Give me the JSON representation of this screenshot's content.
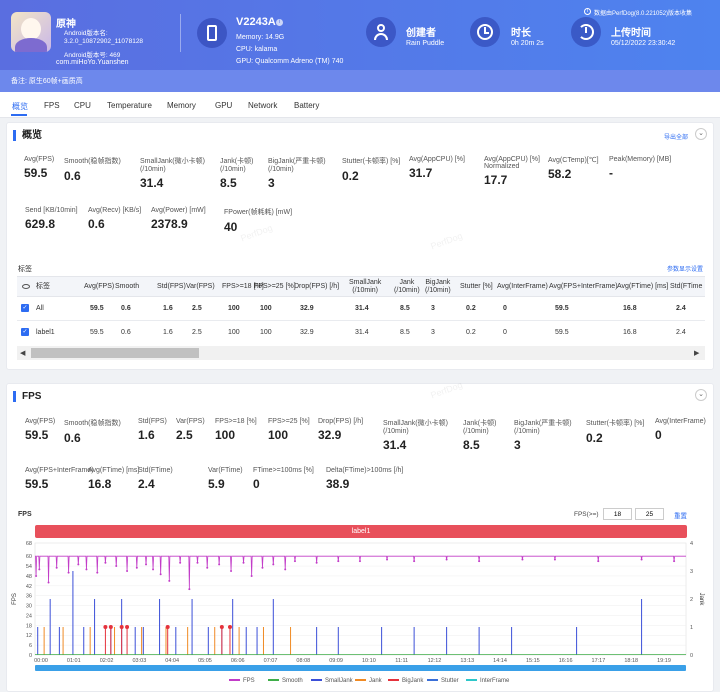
{
  "header": {
    "app_name": "原神",
    "app_version_name": "Android版本名: 3.2.0_10872902_11078128",
    "app_version_code": "Android版本号: 469",
    "package": "com.miHoYo.Yuanshen",
    "device_model": "V2243A",
    "memory": "Memory: 14.9G",
    "cpu": "CPU: kalama",
    "gpu": "GPU: Qualcomm Adreno (TM) 740",
    "creator_label": "创建者",
    "creator_value": "Rain Puddle",
    "duration_label": "时长",
    "duration_value": "0h 20m 2s",
    "upload_label": "上传时间",
    "upload_value": "05/12/2022 23:30:42",
    "source_note": "数据由PerfDog(8.0.221052)版本收集",
    "remark": "备注: 原生60帧+画质高"
  },
  "tabs": [
    "概览",
    "FPS",
    "CPU",
    "Temperature",
    "Memory",
    "GPU",
    "Network",
    "Battery"
  ],
  "overview": {
    "title": "概览",
    "export_label": "导出全部",
    "stats_row1": [
      {
        "label": "Avg(FPS)",
        "value": "59.5"
      },
      {
        "label": "Smooth(稳帧指数)",
        "value": "0.6"
      },
      {
        "label": "SmallJank(微小卡顿)\n(/10min)",
        "value": "31.4"
      },
      {
        "label": "Jank(卡顿)\n(/10min)",
        "value": "8.5"
      },
      {
        "label": "BigJank(严重卡顿)\n(/10min)",
        "value": "3"
      },
      {
        "label": "Stutter(卡顿率) [%]",
        "value": "0.2"
      },
      {
        "label": "Avg(AppCPU) [%]",
        "value": "31.7"
      },
      {
        "label": "Avg(AppCPU) [%]\nNormalized",
        "value": "17.7"
      },
      {
        "label": "Avg(CTemp)[℃]",
        "value": "58.2"
      },
      {
        "label": "Peak(Memory) [MB]",
        "value": "-"
      }
    ],
    "stats_row2": [
      {
        "label": "Send [KB/10min]",
        "value": "629.8"
      },
      {
        "label": "Avg(Recv) [KB/s]",
        "value": "0.6"
      },
      {
        "label": "Avg(Power) [mW]",
        "value": "2378.9"
      },
      {
        "label": "FPower(帧耗耗) [mW]",
        "value": "40"
      }
    ],
    "tag_label": "标签",
    "param_settings": "参数显示设置",
    "table_headers": [
      "标签",
      "Avg(FPS)",
      "Smooth",
      "Std(FPS)",
      "Var(FPS)",
      "FPS>=18 [%]",
      "FPS>=25 [%]",
      "Drop(FPS) [/h]",
      "SmallJank\n(/10min)",
      "Jank\n(/10min)",
      "BigJank\n(/10min)",
      "Stutter [%]",
      "Avg(InterFrame)",
      "Avg(FPS+InterFrame)",
      "Avg(FTime) [ms]",
      "Std(FTime"
    ],
    "rows": [
      {
        "cells": [
          "All",
          "59.5",
          "0.6",
          "1.6",
          "2.5",
          "100",
          "100",
          "32.9",
          "31.4",
          "8.5",
          "3",
          "0.2",
          "0",
          "59.5",
          "16.8",
          "2.4"
        ]
      },
      {
        "cells": [
          "label1",
          "59.5",
          "0.6",
          "1.6",
          "2.5",
          "100",
          "100",
          "32.9",
          "31.4",
          "8.5",
          "3",
          "0.2",
          "0",
          "59.5",
          "16.8",
          "2.4"
        ]
      }
    ]
  },
  "fps_section": {
    "title": "FPS",
    "stats_row1": [
      {
        "label": "Avg(FPS)",
        "value": "59.5"
      },
      {
        "label": "Smooth(稳帧指数)",
        "value": "0.6"
      },
      {
        "label": "Std(FPS)",
        "value": "1.6"
      },
      {
        "label": "Var(FPS)",
        "value": "2.5"
      },
      {
        "label": "FPS>=18 [%]",
        "value": "100"
      },
      {
        "label": "FPS>=25 [%]",
        "value": "100"
      },
      {
        "label": "Drop(FPS) [/h]",
        "value": "32.9"
      },
      {
        "label": "SmallJank(微小卡顿)\n(/10min)",
        "value": "31.4"
      },
      {
        "label": "Jank(卡顿)\n(/10min)",
        "value": "8.5"
      },
      {
        "label": "BigJank(严重卡顿)\n(/10min)",
        "value": "3"
      },
      {
        "label": "Stutter(卡顿率) [%]",
        "value": "0.2"
      },
      {
        "label": "Avg(InterFrame)",
        "value": "0"
      }
    ],
    "stats_row2": [
      {
        "label": "Avg(FPS+InterFrame)",
        "value": "59.5"
      },
      {
        "label": "Avg(FTime) [ms]",
        "value": "16.8"
      },
      {
        "label": "Std(FTime)",
        "value": "2.4"
      },
      {
        "label": "Var(FTime)",
        "value": "5.9"
      },
      {
        "label": "FTime>=100ms [%]",
        "value": "0"
      },
      {
        "label": "Delta(FTime)>100ms [/h]",
        "value": "38.9"
      }
    ],
    "chart_title": "FPS",
    "threshold_label": "FPS(>=)",
    "threshold_a": "18",
    "threshold_b": "25",
    "reset_label": "重置",
    "label_bar": "label1",
    "watermark": "PerfDog"
  },
  "chart_data": {
    "type": "line",
    "title": "FPS",
    "ylabel": "FPS",
    "y2label": "Jank",
    "ylim": [
      0,
      68
    ],
    "y2lim": [
      0,
      4
    ],
    "yticks": [
      0,
      6,
      12,
      18,
      24,
      30,
      36,
      42,
      48,
      54,
      60,
      68
    ],
    "y2ticks": [
      0,
      1,
      2,
      3,
      4
    ],
    "x_ticks": [
      "00:00",
      "01:01",
      "02:02",
      "03:03",
      "04:04",
      "05:05",
      "06:06",
      "07:07",
      "08:08",
      "09:09",
      "10:10",
      "11:11",
      "12:12",
      "13:13",
      "14:14",
      "15:15",
      "16:16",
      "17:17",
      "18:18",
      "19:19"
    ],
    "x_range_s": [
      0,
      1202
    ],
    "legend": [
      "FPS",
      "Smooth",
      "SmallJank",
      "Jank",
      "BigJank",
      "Stutter",
      "InterFrame"
    ],
    "colors": {
      "FPS": "#c23cc8",
      "Smooth": "#3fae49",
      "SmallJank": "#3b4fd8",
      "Jank": "#f08a24",
      "BigJank": "#e5323c",
      "Stutter": "#3a6fd8",
      "InterFrame": "#2ec7c9"
    },
    "fps_baseline": 60,
    "fps_dips": [
      {
        "t": 2,
        "v": 48
      },
      {
        "t": 8,
        "v": 52
      },
      {
        "t": 25,
        "v": 44
      },
      {
        "t": 40,
        "v": 53
      },
      {
        "t": 62,
        "v": 50
      },
      {
        "t": 80,
        "v": 55
      },
      {
        "t": 95,
        "v": 52
      },
      {
        "t": 115,
        "v": 50
      },
      {
        "t": 130,
        "v": 56
      },
      {
        "t": 150,
        "v": 54
      },
      {
        "t": 170,
        "v": 51
      },
      {
        "t": 188,
        "v": 53
      },
      {
        "t": 205,
        "v": 55
      },
      {
        "t": 218,
        "v": 52
      },
      {
        "t": 232,
        "v": 49
      },
      {
        "t": 248,
        "v": 45
      },
      {
        "t": 268,
        "v": 56
      },
      {
        "t": 285,
        "v": 40
      },
      {
        "t": 300,
        "v": 56
      },
      {
        "t": 318,
        "v": 53
      },
      {
        "t": 340,
        "v": 55
      },
      {
        "t": 362,
        "v": 51
      },
      {
        "t": 385,
        "v": 56
      },
      {
        "t": 400,
        "v": 48
      },
      {
        "t": 420,
        "v": 53
      },
      {
        "t": 440,
        "v": 55
      },
      {
        "t": 462,
        "v": 52
      },
      {
        "t": 480,
        "v": 57
      },
      {
        "t": 520,
        "v": 56
      },
      {
        "t": 560,
        "v": 57
      },
      {
        "t": 600,
        "v": 57
      },
      {
        "t": 650,
        "v": 58
      },
      {
        "t": 700,
        "v": 57
      },
      {
        "t": 760,
        "v": 58
      },
      {
        "t": 820,
        "v": 57
      },
      {
        "t": 900,
        "v": 58
      },
      {
        "t": 960,
        "v": 58
      },
      {
        "t": 1040,
        "v": 57
      },
      {
        "t": 1120,
        "v": 58
      },
      {
        "t": 1180,
        "v": 57
      }
    ],
    "smalljank_spikes": [
      {
        "t": 5,
        "v": 1
      },
      {
        "t": 28,
        "v": 2
      },
      {
        "t": 45,
        "v": 1
      },
      {
        "t": 70,
        "v": 3
      },
      {
        "t": 90,
        "v": 1
      },
      {
        "t": 110,
        "v": 2
      },
      {
        "t": 140,
        "v": 1
      },
      {
        "t": 160,
        "v": 2
      },
      {
        "t": 185,
        "v": 1
      },
      {
        "t": 200,
        "v": 1
      },
      {
        "t": 230,
        "v": 2
      },
      {
        "t": 260,
        "v": 1
      },
      {
        "t": 290,
        "v": 2
      },
      {
        "t": 320,
        "v": 1
      },
      {
        "t": 345,
        "v": 1
      },
      {
        "t": 365,
        "v": 2
      },
      {
        "t": 390,
        "v": 1
      },
      {
        "t": 410,
        "v": 1
      },
      {
        "t": 440,
        "v": 2
      },
      {
        "t": 520,
        "v": 1
      },
      {
        "t": 560,
        "v": 1
      },
      {
        "t": 640,
        "v": 1
      },
      {
        "t": 700,
        "v": 1
      },
      {
        "t": 760,
        "v": 1
      },
      {
        "t": 820,
        "v": 1
      },
      {
        "t": 880,
        "v": 1
      },
      {
        "t": 1000,
        "v": 1
      },
      {
        "t": 1120,
        "v": 2
      }
    ],
    "jank_spikes": [
      {
        "t": 15,
        "v": 1
      },
      {
        "t": 50,
        "v": 1
      },
      {
        "t": 100,
        "v": 1
      },
      {
        "t": 145,
        "v": 1
      },
      {
        "t": 195,
        "v": 1
      },
      {
        "t": 240,
        "v": 1
      },
      {
        "t": 280,
        "v": 1
      },
      {
        "t": 330,
        "v": 1
      },
      {
        "t": 375,
        "v": 1
      },
      {
        "t": 420,
        "v": 1
      },
      {
        "t": 470,
        "v": 1
      }
    ],
    "bigjank_spikes": [
      {
        "t": 130,
        "v": 1
      },
      {
        "t": 140,
        "v": 1
      },
      {
        "t": 160,
        "v": 1
      },
      {
        "t": 170,
        "v": 1
      },
      {
        "t": 245,
        "v": 1
      },
      {
        "t": 345,
        "v": 1
      },
      {
        "t": 360,
        "v": 1
      }
    ]
  }
}
